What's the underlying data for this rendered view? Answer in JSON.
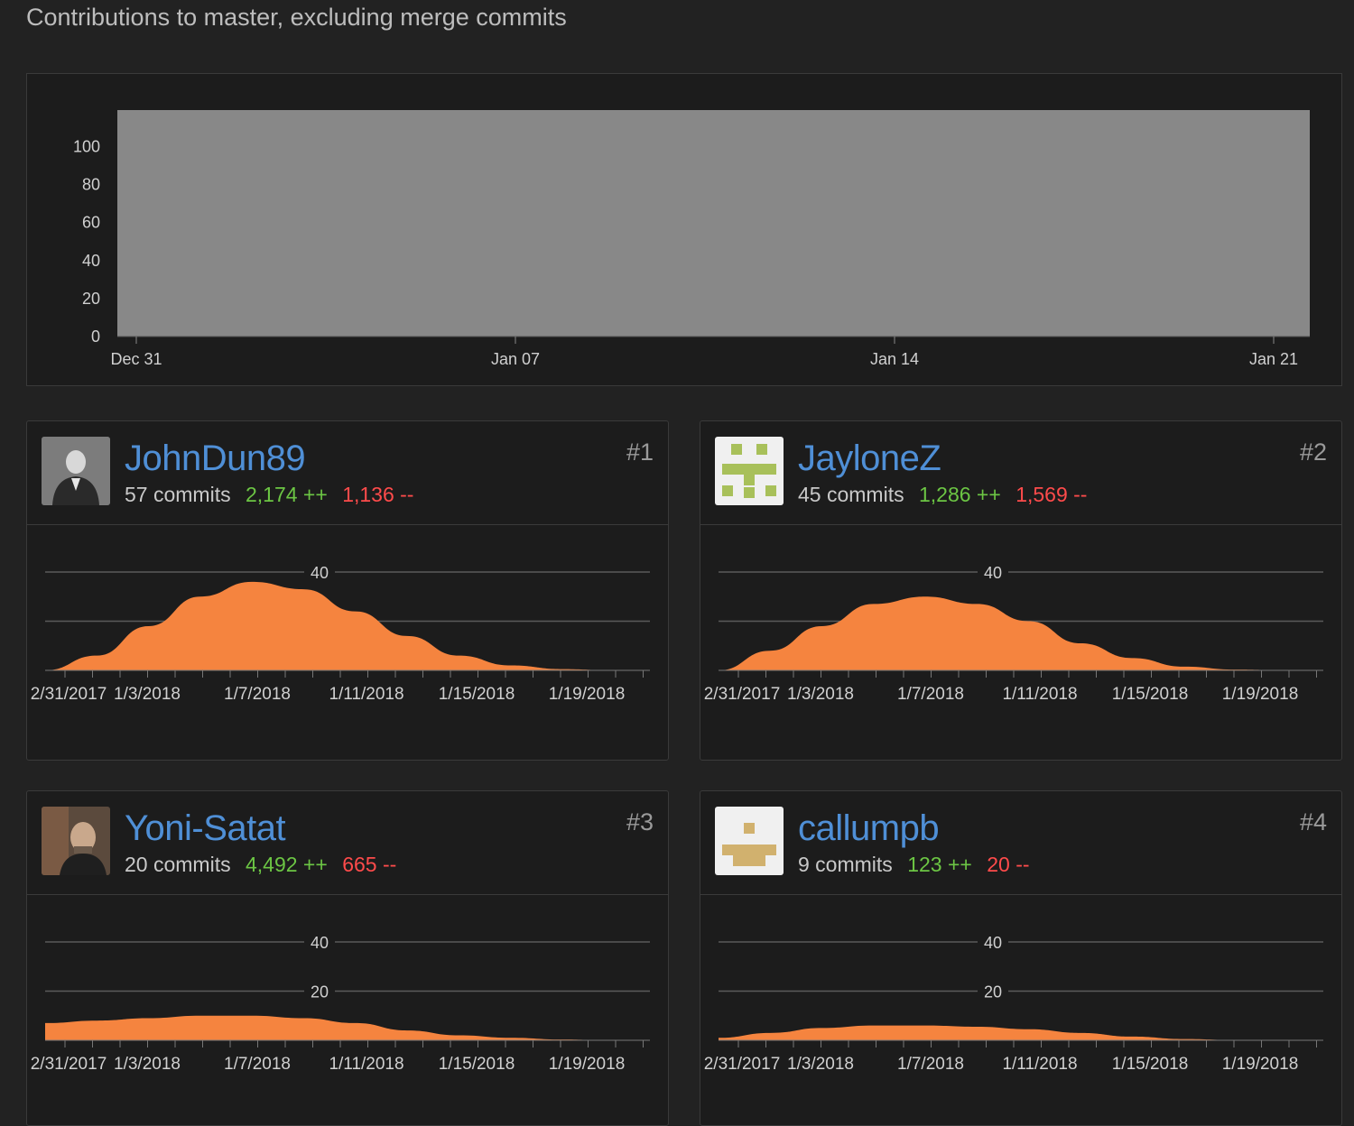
{
  "subtitle": "Contributions to master, excluding merge commits",
  "chart_data": [
    {
      "type": "area",
      "y_ticks": [
        0,
        20,
        40,
        60,
        80,
        100
      ],
      "x_ticks": [
        "Dec 31",
        "Jan 07",
        "Jan 14",
        "Jan 21"
      ],
      "grid": false,
      "fill_color": "#888888"
    }
  ],
  "contributors": [
    {
      "rank": "#1",
      "username": "JohnDun89",
      "commits": "57 commits",
      "additions": "2,174 ++",
      "deletions": "1,136 --",
      "avatar_icon": "photo-avatar",
      "y_ticks": [
        "40"
      ],
      "x_ticks": [
        "2/31/2017",
        "1/3/2018",
        "1/7/2018",
        "1/11/2018",
        "1/15/2018",
        "1/19/2018"
      ],
      "weekly_commits": [
        0,
        6,
        18,
        30,
        36,
        33,
        24,
        14,
        6,
        2,
        0.5,
        0
      ],
      "color": "#f5843f"
    },
    {
      "rank": "#2",
      "username": "JayloneZ",
      "commits": "45 commits",
      "additions": "1,286 ++",
      "deletions": "1,569 --",
      "avatar_icon": "identicon-green",
      "y_ticks": [
        "40"
      ],
      "x_ticks": [
        "2/31/2017",
        "1/3/2018",
        "1/7/2018",
        "1/11/2018",
        "1/15/2018",
        "1/19/2018"
      ],
      "weekly_commits": [
        0,
        8,
        18,
        27,
        30,
        27,
        20,
        11,
        5,
        1.5,
        0.3,
        0
      ],
      "color": "#f5843f"
    },
    {
      "rank": "#3",
      "username": "Yoni-Satat",
      "commits": "20 commits",
      "additions": "4,492 ++",
      "deletions": "665 --",
      "avatar_icon": "photo-avatar",
      "y_ticks": [
        "40",
        "20"
      ],
      "x_ticks": [
        "2/31/2017",
        "1/3/2018",
        "1/7/2018",
        "1/11/2018",
        "1/15/2018",
        "1/19/2018"
      ],
      "weekly_commits": [
        7,
        8,
        9,
        10,
        10,
        9,
        7,
        4,
        2,
        1,
        0.3,
        0
      ],
      "color": "#f5843f"
    },
    {
      "rank": "#4",
      "username": "callumpb",
      "commits": "9 commits",
      "additions": "123 ++",
      "deletions": "20 --",
      "avatar_icon": "identicon-tan",
      "y_ticks": [
        "40",
        "20"
      ],
      "x_ticks": [
        "2/31/2017",
        "1/3/2018",
        "1/7/2018",
        "1/11/2018",
        "1/15/2018",
        "1/19/2018"
      ],
      "weekly_commits": [
        1,
        3,
        5,
        6,
        6,
        5.5,
        4.5,
        3,
        1.5,
        0.5,
        0.1,
        0
      ],
      "color": "#f5843f"
    }
  ]
}
